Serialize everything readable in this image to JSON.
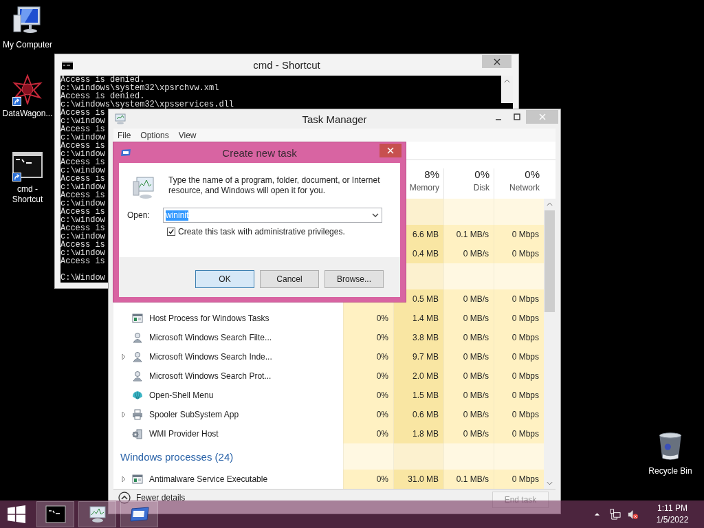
{
  "desktop_icons": [
    {
      "label": "My Computer",
      "kind": "computer",
      "shortcut": false
    },
    {
      "label": "DataWagon...",
      "kind": "star",
      "shortcut": true
    },
    {
      "label": "cmd - Shortcut",
      "kind": "console",
      "shortcut": true
    },
    {
      "label": "Recycle Bin",
      "kind": "bin",
      "shortcut": false
    }
  ],
  "cmd_window": {
    "title": "cmd - Shortcut",
    "lines": [
      "Access is denied.",
      "c:\\windows\\system32\\xpsrchvw.xml",
      "Access is denied.",
      "c:\\windows\\system32\\xpsservices.dll",
      "Access is",
      "c:\\window",
      "Access is",
      "c:\\window",
      "Access is",
      "c:\\window",
      "Access is",
      "c:\\window",
      "Access is",
      "c:\\window",
      "Access is",
      "c:\\window",
      "Access is",
      "c:\\window",
      "Access is",
      "c:\\window",
      "Access is",
      "c:\\window",
      "Access is"
    ],
    "prompt": "C:\\Window"
  },
  "task_manager": {
    "title": "Task Manager",
    "menu": [
      "File",
      "Options",
      "View"
    ],
    "columns": [
      {
        "percent": "8%",
        "label": "Memory"
      },
      {
        "percent": "0%",
        "label": "Disk"
      },
      {
        "percent": "0%",
        "label": "Network"
      }
    ],
    "rows": [
      {
        "kind": "group"
      },
      {
        "kind": "process",
        "memory": "6.6 MB",
        "disk": "0.1 MB/s",
        "network": "0 Mbps"
      },
      {
        "kind": "process",
        "memory": "0.4 MB",
        "disk": "0 MB/s",
        "network": "0 Mbps"
      },
      {
        "kind": "group"
      },
      {
        "kind": "process",
        "memory": "0.5 MB",
        "disk": "0 MB/s",
        "network": "0 Mbps"
      },
      {
        "kind": "process",
        "name": "Host Process for Windows Tasks",
        "expandable": false,
        "cpu": "0%",
        "memory": "1.4 MB",
        "disk": "0 MB/s",
        "network": "0 Mbps"
      },
      {
        "kind": "process",
        "name": "Microsoft Windows Search Filte...",
        "expandable": false,
        "cpu": "0%",
        "memory": "3.8 MB",
        "disk": "0 MB/s",
        "network": "0 Mbps"
      },
      {
        "kind": "process",
        "name": "Microsoft Windows Search Inde...",
        "expandable": true,
        "cpu": "0%",
        "memory": "9.7 MB",
        "disk": "0 MB/s",
        "network": "0 Mbps"
      },
      {
        "kind": "process",
        "name": "Microsoft Windows Search Prot...",
        "expandable": false,
        "cpu": "0%",
        "memory": "2.0 MB",
        "disk": "0 MB/s",
        "network": "0 Mbps"
      },
      {
        "kind": "process",
        "name": "Open-Shell Menu",
        "expandable": false,
        "cpu": "0%",
        "memory": "1.5 MB",
        "disk": "0 MB/s",
        "network": "0 Mbps"
      },
      {
        "kind": "process",
        "name": "Spooler SubSystem App",
        "expandable": true,
        "cpu": "0%",
        "memory": "0.6 MB",
        "disk": "0 MB/s",
        "network": "0 Mbps"
      },
      {
        "kind": "process",
        "name": "WMI Provider Host",
        "expandable": false,
        "cpu": "0%",
        "memory": "1.8 MB",
        "disk": "0 MB/s",
        "network": "0 Mbps"
      },
      {
        "kind": "group",
        "name": "Windows processes (24)"
      },
      {
        "kind": "process",
        "name": "Antimalware Service Executable",
        "expandable": true,
        "cpu": "0%",
        "memory": "31.0 MB",
        "disk": "0.1 MB/s",
        "network": "0 Mbps"
      }
    ],
    "fewer_details": "Fewer details",
    "end_task": {
      "label": "End task",
      "disabled": true
    }
  },
  "dialog": {
    "title": "Create new task",
    "message": "Type the name of a program, folder, document, or Internet resource, and Windows will open it for you.",
    "open_label": "Open:",
    "value": "wininit",
    "admin": {
      "label": "Create this task with administrative privileges.",
      "checked": true
    },
    "buttons": [
      {
        "label": "OK",
        "default": true
      },
      {
        "label": "Cancel",
        "default": false
      },
      {
        "label": "Browse...",
        "default": false
      }
    ]
  },
  "taskbar": {
    "apps": [
      {
        "kind": "console"
      },
      {
        "kind": "monitor"
      },
      {
        "kind": "window"
      }
    ],
    "time": "1:11 PM",
    "date": "1/5/2022"
  }
}
